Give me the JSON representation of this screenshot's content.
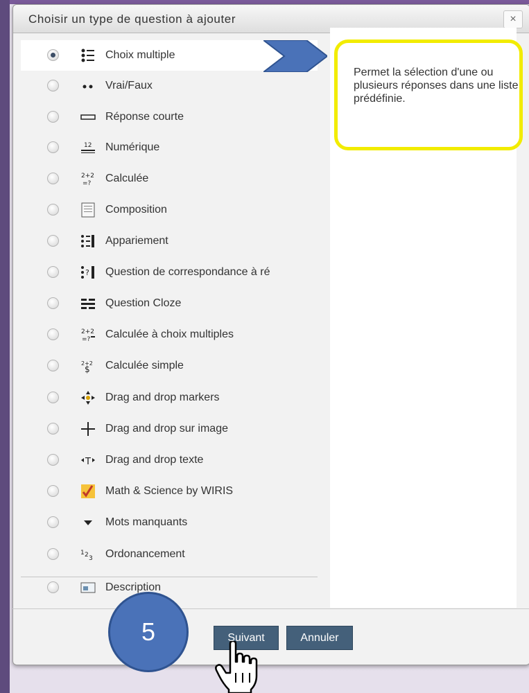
{
  "dialog": {
    "title": "Choisir un type de question à ajouter",
    "close_symbol": "×"
  },
  "question_types": [
    {
      "label": "Choix multiple",
      "icon": "multichoice-icon",
      "selected": true
    },
    {
      "label": "Vrai/Faux",
      "icon": "truefalse-icon",
      "selected": false
    },
    {
      "label": "Réponse courte",
      "icon": "shortanswer-icon",
      "selected": false
    },
    {
      "label": "Numérique",
      "icon": "numerical-icon",
      "selected": false
    },
    {
      "label": "Calculée",
      "icon": "calculated-icon",
      "selected": false
    },
    {
      "label": "Composition",
      "icon": "essay-icon",
      "selected": false
    },
    {
      "label": "Appariement",
      "icon": "match-icon",
      "selected": false
    },
    {
      "label": "Question de correspondance à ré",
      "icon": "random-match-icon",
      "selected": false
    },
    {
      "label": "Question Cloze",
      "icon": "cloze-icon",
      "selected": false
    },
    {
      "label": "Calculée à choix multiples",
      "icon": "calculated-multi-icon",
      "selected": false
    },
    {
      "label": "Calculée simple",
      "icon": "calculated-simple-icon",
      "selected": false
    },
    {
      "label": "Drag and drop markers",
      "icon": "ddmarker-icon",
      "selected": false
    },
    {
      "label": "Drag and drop sur image",
      "icon": "ddimage-icon",
      "selected": false
    },
    {
      "label": "Drag and drop texte",
      "icon": "ddtext-icon",
      "selected": false
    },
    {
      "label": "Math & Science by WIRIS",
      "icon": "wiris-icon",
      "selected": false
    },
    {
      "label": "Mots manquants",
      "icon": "gapselect-icon",
      "selected": false
    },
    {
      "label": "Ordonancement",
      "icon": "ordering-icon",
      "selected": false
    },
    {
      "label": "Description",
      "icon": "description-icon",
      "selected": false
    }
  ],
  "description_panel": {
    "text": "Permet la sélection d'une ou plusieurs réponses dans une liste prédéfinie."
  },
  "footer": {
    "next_label": "Suivant",
    "cancel_label": "Annuler"
  },
  "annotation": {
    "step_number": "5"
  },
  "colors": {
    "callout_border": "#f2ec00",
    "arrow": "#4a72b8",
    "button": "#44607a"
  }
}
